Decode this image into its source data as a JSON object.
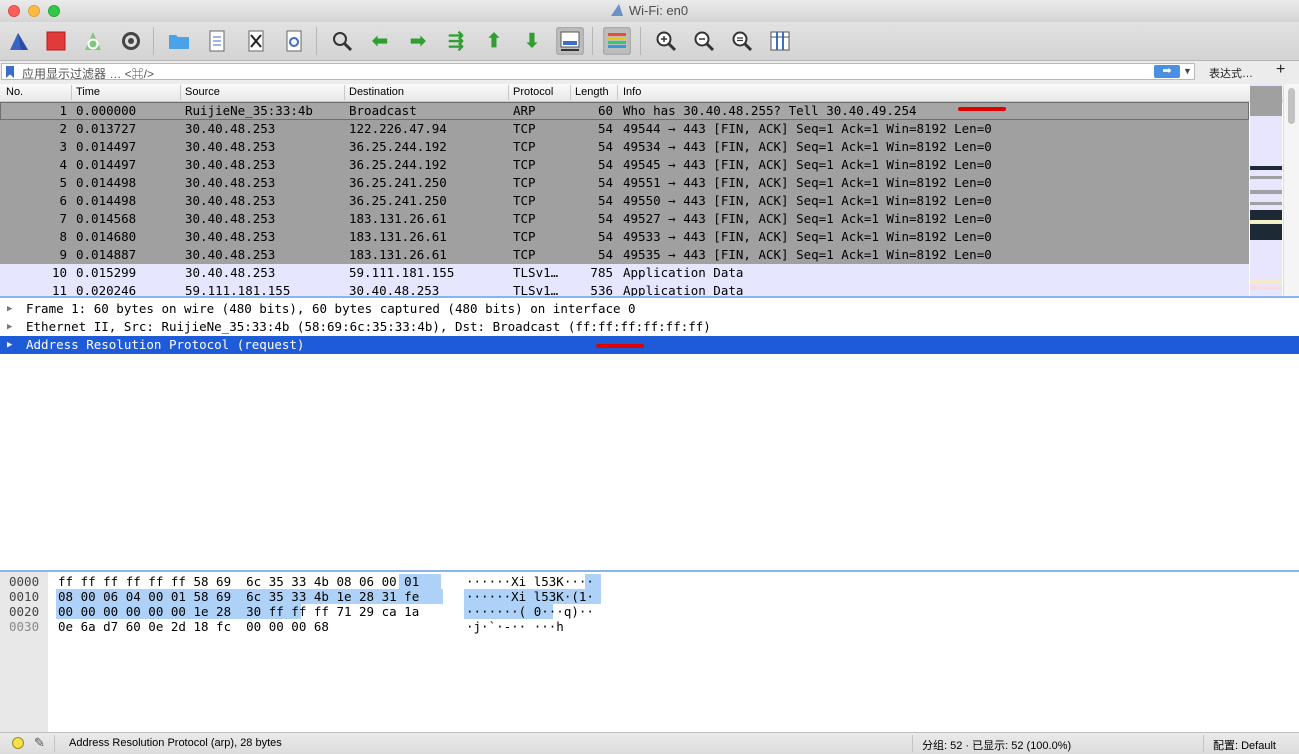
{
  "window": {
    "title": "Wi-Fi: en0"
  },
  "toolbar": {
    "icons": [
      "shark-fin-icon",
      "stop-icon",
      "restart-icon",
      "gear-icon",
      "folder-icon",
      "file-icon",
      "close-file-icon",
      "reload-icon",
      "search-icon",
      "arrow-left-icon",
      "arrow-right-icon",
      "jump-icon",
      "arrow-up-icon",
      "arrow-down-icon",
      "autoscroll-icon",
      "colorize-icon",
      "zoom-in-icon",
      "zoom-out-icon",
      "zoom-reset-icon",
      "resize-columns-icon"
    ]
  },
  "filter": {
    "placeholder": "应用显示过滤器 … <⌘/>",
    "expression_label": "表达式…",
    "add_label": "+"
  },
  "packet_list": {
    "columns": [
      "No.",
      "Time",
      "Source",
      "Destination",
      "Protocol",
      "Length",
      "Info"
    ],
    "rows": [
      {
        "no": "1",
        "time": "0.000000",
        "src": "RuijieNe_35:33:4b",
        "dst": "Broadcast",
        "proto": "ARP",
        "len": "60",
        "info": "Who has 30.40.48.255? Tell 30.40.49.254"
      },
      {
        "no": "2",
        "time": "0.013727",
        "src": "30.40.48.253",
        "dst": "122.226.47.94",
        "proto": "TCP",
        "len": "54",
        "info": "49544 → 443 [FIN, ACK] Seq=1 Ack=1 Win=8192 Len=0"
      },
      {
        "no": "3",
        "time": "0.014497",
        "src": "30.40.48.253",
        "dst": "36.25.244.192",
        "proto": "TCP",
        "len": "54",
        "info": "49534 → 443 [FIN, ACK] Seq=1 Ack=1 Win=8192 Len=0"
      },
      {
        "no": "4",
        "time": "0.014497",
        "src": "30.40.48.253",
        "dst": "36.25.244.192",
        "proto": "TCP",
        "len": "54",
        "info": "49545 → 443 [FIN, ACK] Seq=1 Ack=1 Win=8192 Len=0"
      },
      {
        "no": "5",
        "time": "0.014498",
        "src": "30.40.48.253",
        "dst": "36.25.241.250",
        "proto": "TCP",
        "len": "54",
        "info": "49551 → 443 [FIN, ACK] Seq=1 Ack=1 Win=8192 Len=0"
      },
      {
        "no": "6",
        "time": "0.014498",
        "src": "30.40.48.253",
        "dst": "36.25.241.250",
        "proto": "TCP",
        "len": "54",
        "info": "49550 → 443 [FIN, ACK] Seq=1 Ack=1 Win=8192 Len=0"
      },
      {
        "no": "7",
        "time": "0.014568",
        "src": "30.40.48.253",
        "dst": "183.131.26.61",
        "proto": "TCP",
        "len": "54",
        "info": "49527 → 443 [FIN, ACK] Seq=1 Ack=1 Win=8192 Len=0"
      },
      {
        "no": "8",
        "time": "0.014680",
        "src": "30.40.48.253",
        "dst": "183.131.26.61",
        "proto": "TCP",
        "len": "54",
        "info": "49533 → 443 [FIN, ACK] Seq=1 Ack=1 Win=8192 Len=0"
      },
      {
        "no": "9",
        "time": "0.014887",
        "src": "30.40.48.253",
        "dst": "183.131.26.61",
        "proto": "TCP",
        "len": "54",
        "info": "49535 → 443 [FIN, ACK] Seq=1 Ack=1 Win=8192 Len=0"
      },
      {
        "no": "10",
        "time": "0.015299",
        "src": "30.40.48.253",
        "dst": "59.111.181.155",
        "proto": "TLSv1…",
        "len": "785",
        "info": "Application Data"
      },
      {
        "no": "11",
        "time": "0.020246",
        "src": "59.111.181.155",
        "dst": "30.40.48.253",
        "proto": "TLSv1…",
        "len": "536",
        "info": "Application Data"
      }
    ]
  },
  "details": {
    "rows": [
      "Frame 1: 60 bytes on wire (480 bits), 60 bytes captured (480 bits) on interface 0",
      "Ethernet II, Src: RuijieNe_35:33:4b (58:69:6c:35:33:4b), Dst: Broadcast (ff:ff:ff:ff:ff:ff)",
      "Address Resolution Protocol (request)"
    ]
  },
  "bytes": {
    "rows": [
      {
        "offset": "0000",
        "hex": "ff ff ff ff ff ff 58 69  6c 35 33 4b 08 06 00 01",
        "ascii": "······Xi l53K····"
      },
      {
        "offset": "0010",
        "hex": "08 00 06 04 00 01 58 69  6c 35 33 4b 1e 28 31 fe",
        "ascii": "······Xi l53K·(1·"
      },
      {
        "offset": "0020",
        "hex": "00 00 00 00 00 00 1e 28  30 ff ff ff 71 29 ca 1a",
        "ascii": "·······( 0···q)··"
      },
      {
        "offset": "0030",
        "hex": "0e 6a d7 60 0e 2d 18 fc  00 00 00 68",
        "ascii": "·j·`·-·· ···h"
      }
    ]
  },
  "status": {
    "text": "Address Resolution Protocol (arp), 28 bytes",
    "packets": "分组: 52 · 已显示: 52 (100.0%)",
    "profile": "配置: Default"
  },
  "colors": {
    "selected_tree_row": "#1e5bd8",
    "tcp_row": "#a0a0a0",
    "tls_row": "#e7e6ff",
    "byte_highlight": "#aed2f7",
    "annotation": "#e00000"
  }
}
